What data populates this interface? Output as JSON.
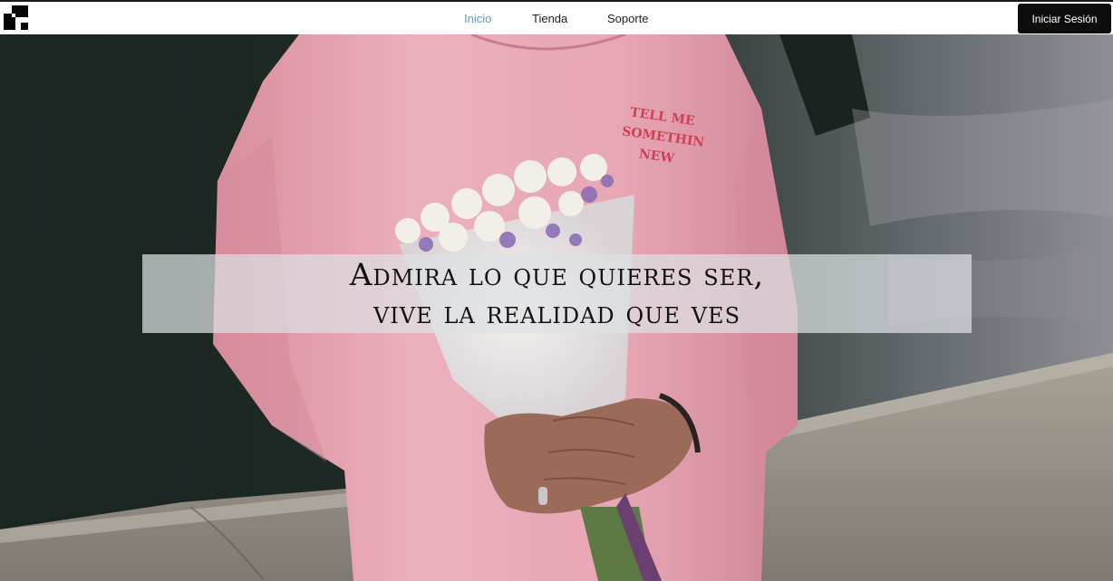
{
  "nav": {
    "logo": "logo-icon",
    "links": [
      "Inicio",
      "Tienda",
      "Soporte"
    ],
    "active_link": "Inicio",
    "login_label": "Iniciar Sesión"
  },
  "hero": {
    "shirt_print": [
      "TELL ME",
      "SOMETHIN",
      "NEW"
    ],
    "caption_line1": "Admira lo que quieres ser,",
    "caption_line2": "vive la realidad que ves"
  },
  "colors": {
    "active_link": "#5a9db5",
    "login_bg": "#0d0d0d",
    "hoodie": "#e9a9b6",
    "water": "#1f2a27"
  }
}
